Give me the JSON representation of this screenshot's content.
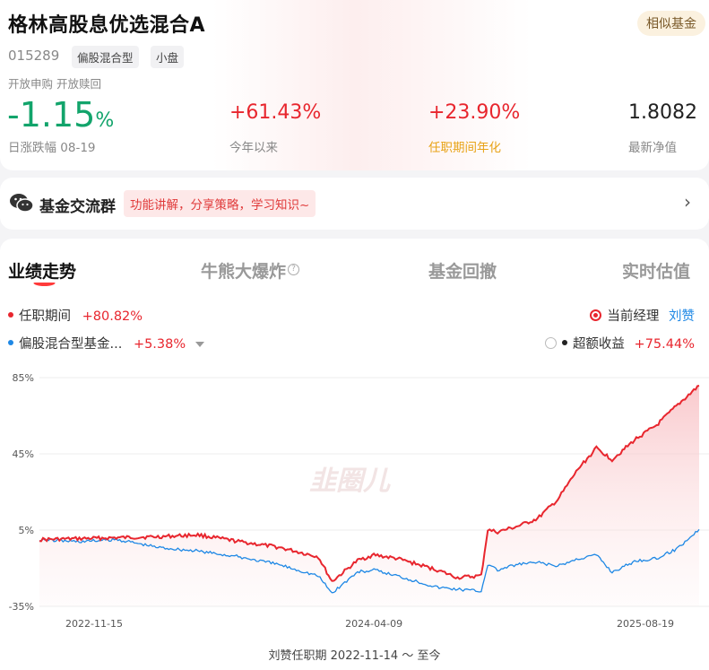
{
  "fund": {
    "name": "格林高股息优选混合A",
    "code": "015289",
    "tags": [
      "偏股混合型",
      "小盘"
    ],
    "status": "开放申购  开放赎回",
    "similar_label": "相似基金"
  },
  "metrics": {
    "daily_change": "-1.15",
    "daily_change_unit": "%",
    "daily_change_label": "日涨跌幅 08-19",
    "ytd": "+61.43%",
    "ytd_label": "今年以来",
    "tenure_annual": "+23.90%",
    "tenure_annual_label": "任职期间年化",
    "nav": "1.8082",
    "nav_label": "最新净值"
  },
  "chat": {
    "title": "基金交流群",
    "promo": "功能讲解，分享策略，学习知识~"
  },
  "tabs": [
    "业绩走势",
    "牛熊大爆炸",
    "基金回撤",
    "实时估值"
  ],
  "legend": {
    "series1_label": "任职期间",
    "series1_value": "+80.82%",
    "series2_label": "偏股混合型基金...",
    "series2_value": "+5.38%",
    "manager_option": "当前经理",
    "manager_name": "刘赞",
    "excess_option": "超额收益",
    "excess_value": "+75.44%"
  },
  "watermark": "韭圈儿",
  "footer": "刘赞任职期 2022-11-14 ～ 至今",
  "colors": {
    "red": "#e8262e",
    "blue": "#1e88e5",
    "green": "#12a46b"
  },
  "chart_data": {
    "type": "line",
    "yticks": [
      "85%",
      "45%",
      "5%",
      "-35%"
    ],
    "ylim": [
      -35,
      85
    ],
    "xticks": [
      "2022-11-15",
      "2024-04-09",
      "2025-08-19"
    ],
    "series": [
      {
        "name": "任职期间",
        "x": [
          "2022-11-15",
          "2023-01-15",
          "2023-03-15",
          "2023-05-15",
          "2023-07-15",
          "2023-09-15",
          "2023-11-15",
          "2024-01-15",
          "2024-02-05",
          "2024-03-15",
          "2024-04-09",
          "2024-05-15",
          "2024-06-15",
          "2024-07-15",
          "2024-08-15",
          "2024-09-20",
          "2024-09-30",
          "2024-10-15",
          "2024-11-15",
          "2024-12-15",
          "2025-01-15",
          "2025-02-15",
          "2025-03-15",
          "2025-04-08",
          "2025-05-15",
          "2025-06-15",
          "2025-07-15",
          "2025-08-19"
        ],
        "values": [
          0,
          0.5,
          1,
          1.5,
          2.5,
          -1,
          -4,
          -9,
          -22,
          -11,
          -8,
          -10,
          -13,
          -16,
          -20,
          -19,
          5,
          4,
          7,
          11,
          21,
          37,
          48,
          42,
          53,
          60,
          70,
          80.8
        ]
      },
      {
        "name": "偏股混合型基金...",
        "x": [
          "2022-11-15",
          "2023-01-15",
          "2023-03-15",
          "2023-05-15",
          "2023-07-15",
          "2023-09-15",
          "2023-11-15",
          "2024-01-15",
          "2024-02-05",
          "2024-03-15",
          "2024-04-09",
          "2024-05-15",
          "2024-06-15",
          "2024-07-15",
          "2024-08-15",
          "2024-09-20",
          "2024-09-30",
          "2024-10-15",
          "2024-11-15",
          "2024-12-15",
          "2025-01-15",
          "2025-02-15",
          "2025-03-15",
          "2025-04-08",
          "2025-05-15",
          "2025-06-15",
          "2025-07-15",
          "2025-08-19"
        ],
        "values": [
          0,
          -1,
          0,
          -4,
          -6,
          -9,
          -13,
          -19,
          -28,
          -17,
          -16,
          -19,
          -22,
          -25,
          -26,
          -27,
          -13,
          -16,
          -13,
          -12,
          -14,
          -10,
          -8,
          -17,
          -11,
          -10,
          -5,
          5.4
        ]
      }
    ]
  }
}
